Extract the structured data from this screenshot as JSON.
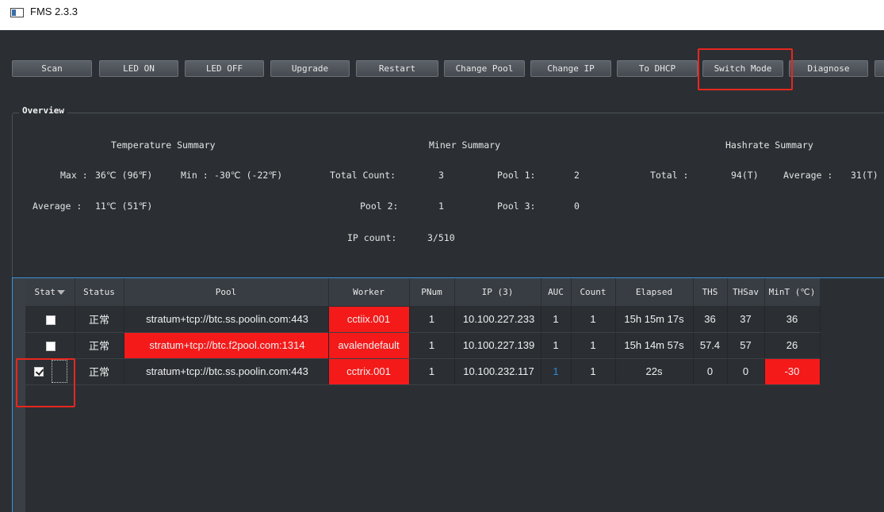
{
  "window": {
    "title": "FMS 2.3.3"
  },
  "toolbar": {
    "buttons": [
      "Scan",
      "LED ON",
      "LED OFF",
      "Upgrade",
      "Restart",
      "Change Pool",
      "Change IP",
      "To DHCP",
      "Switch Mode",
      "Diagnose"
    ]
  },
  "overview": {
    "title": "Overview",
    "temperature": {
      "heading": "Temperature Summary",
      "max_label": "Max :",
      "max_value": "36℃ (96℉)",
      "min_label": "Min :",
      "min_value": "-30℃ (-22℉)",
      "avg_label": "Average :",
      "avg_value": "11℃ (51℉)"
    },
    "miner": {
      "heading": "Miner Summary",
      "total_count_label": "Total Count:",
      "total_count_value": "3",
      "pool1_label": "Pool 1:",
      "pool1_value": "2",
      "pool2_label": "Pool 2:",
      "pool2_value": "1",
      "pool3_label": "Pool 3:",
      "pool3_value": "0",
      "ip_count_label": "IP count:",
      "ip_count_value": "3/510"
    },
    "hashrate": {
      "heading": "Hashrate Summary",
      "total_label": "Total :",
      "total_value": "94(T)",
      "average_label": "Average :",
      "average_value": "31(T)"
    }
  },
  "table": {
    "columns": [
      "Stat",
      "Status",
      "Pool",
      "Worker",
      "PNum",
      "IP (3)",
      "AUC",
      "Count",
      "Elapsed",
      "THS",
      "THSav",
      "MinT (℃)"
    ],
    "rows": [
      {
        "checked": false,
        "status": "正常",
        "pool": "stratum+tcp://btc.ss.poolin.com:443",
        "worker": "cctiix.001",
        "pnum": "1",
        "ip": "10.100.227.233",
        "auc": "1",
        "count": "1",
        "elapsed": "15h 15m 17s",
        "ths": "36",
        "thsav": "37",
        "mint": "36"
      },
      {
        "checked": false,
        "status": "正常",
        "pool": "stratum+tcp://btc.f2pool.com:1314",
        "worker": "avalendefault",
        "pnum": "1",
        "ip": "10.100.227.139",
        "auc": "1",
        "count": "1",
        "elapsed": "15h 14m 57s",
        "ths": "57.4",
        "thsav": "57",
        "mint": "26"
      },
      {
        "checked": true,
        "status": "正常",
        "pool": "stratum+tcp://btc.ss.poolin.com:443",
        "worker": "cctrix.001",
        "pnum": "1",
        "ip": "10.100.232.117",
        "auc": "1",
        "count": "1",
        "elapsed": "22s",
        "ths": "0",
        "thsav": "0",
        "mint": "-30"
      }
    ]
  },
  "colors": {
    "alert_red": "#f41a1a",
    "highlight_red": "#e8261f",
    "panel_bg": "#2b2f33",
    "auc_blue": "#2a8adf"
  }
}
